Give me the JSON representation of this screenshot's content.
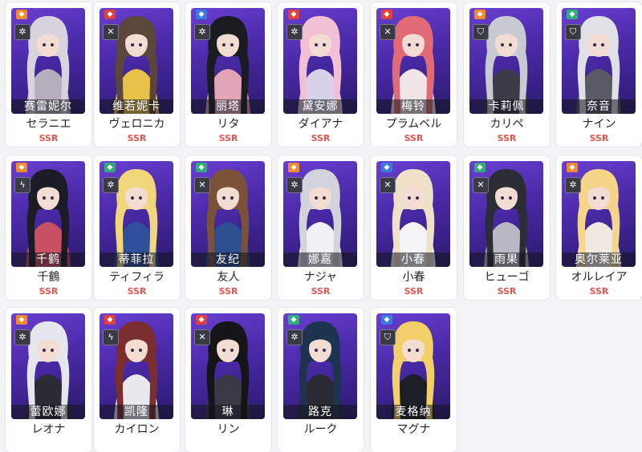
{
  "colors": {
    "burst-orange": "#f08a2a",
    "burst-red": "#e0413b",
    "burst-green": "#2fae7a",
    "burst-blue": "#3a7be0",
    "rarity": "#e0564f"
  },
  "characters": [
    {
      "cn": "赛雷妮尔",
      "jp": "セラニエ",
      "rarity": "SSR",
      "badge": "orange",
      "cls_icon": "gear-icon"
    },
    {
      "cn": "维若妮卡",
      "jp": "ヴェロニカ",
      "rarity": "SSR",
      "badge": "red",
      "cls_icon": "crossed-swords-icon"
    },
    {
      "cn": "丽塔",
      "jp": "リタ",
      "rarity": "SSR",
      "badge": "blue",
      "cls_icon": "gear-icon"
    },
    {
      "cn": "黛安娜",
      "jp": "ダイアナ",
      "rarity": "SSR",
      "badge": "red",
      "cls_icon": "gear-icon"
    },
    {
      "cn": "梅铃",
      "jp": "プラムベル",
      "rarity": "SSR",
      "badge": "red",
      "cls_icon": "crossed-swords-icon"
    },
    {
      "cn": "卡莉佩",
      "jp": "カリペ",
      "rarity": "SSR",
      "badge": "orange",
      "cls_icon": "shield-icon"
    },
    {
      "cn": "奈音",
      "jp": "ナイン",
      "rarity": "SSR",
      "badge": "green",
      "cls_icon": "shield-icon"
    },
    {
      "cn": "千鹤",
      "jp": "千鶴",
      "rarity": "SSR",
      "badge": "orange",
      "cls_icon": "bolt-icon"
    },
    {
      "cn": "蒂菲拉",
      "jp": "ティフィラ",
      "rarity": "SSR",
      "badge": "green",
      "cls_icon": "gear-icon"
    },
    {
      "cn": "友纪",
      "jp": "友人",
      "rarity": "SSR",
      "badge": "green",
      "cls_icon": "crossed-swords-icon"
    },
    {
      "cn": "娜嘉",
      "jp": "ナジャ",
      "rarity": "SSR",
      "badge": "orange",
      "cls_icon": "gear-icon"
    },
    {
      "cn": "小春",
      "jp": "小春",
      "rarity": "SSR",
      "badge": "blue",
      "cls_icon": "crossed-swords-icon"
    },
    {
      "cn": "雨果",
      "jp": "ヒューゴ",
      "rarity": "SSR",
      "badge": "green",
      "cls_icon": "crossed-swords-icon"
    },
    {
      "cn": "奥尔莱亚",
      "jp": "オルレイア",
      "rarity": "SSR",
      "badge": "orange",
      "cls_icon": "gear-icon"
    },
    {
      "cn": "蕾欧娜",
      "jp": "レオナ",
      "rarity": "",
      "badge": "orange",
      "cls_icon": "gear-icon"
    },
    {
      "cn": "凯隆",
      "jp": "カイロン",
      "rarity": "",
      "badge": "red",
      "cls_icon": "bolt-icon"
    },
    {
      "cn": "琳",
      "jp": "リン",
      "rarity": "",
      "badge": "red",
      "cls_icon": "crossed-swords-icon"
    },
    {
      "cn": "路克",
      "jp": "ルーク",
      "rarity": "",
      "badge": "green",
      "cls_icon": "gear-icon"
    },
    {
      "cn": "麦格纳",
      "jp": "マグナ",
      "rarity": "",
      "badge": "blue",
      "cls_icon": "shield-icon"
    }
  ]
}
